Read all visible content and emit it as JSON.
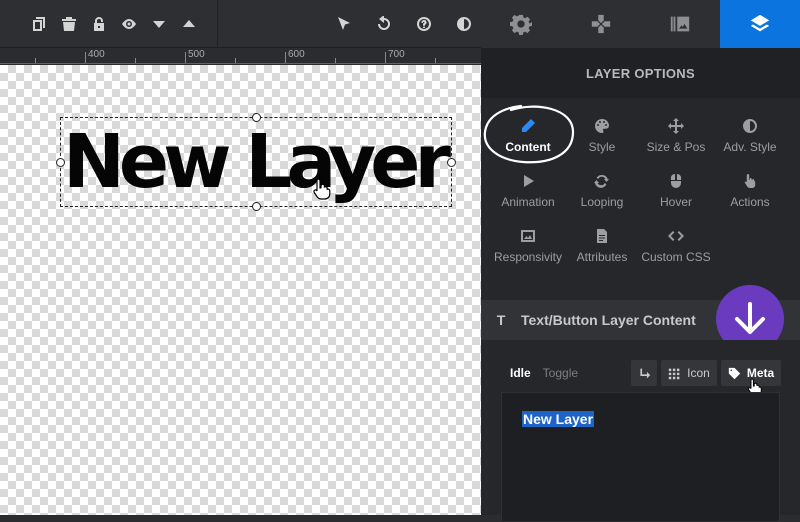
{
  "ruler": {
    "ticks": [
      "400",
      "500",
      "600",
      "700"
    ]
  },
  "canvas": {
    "layer_text": "New Layer"
  },
  "panel": {
    "title": "LAYER OPTIONS",
    "options": [
      {
        "label": "Content",
        "icon": "pencil-icon"
      },
      {
        "label": "Style",
        "icon": "palette-icon"
      },
      {
        "label": "Size & Pos",
        "icon": "move-arrows-icon"
      },
      {
        "label": "Adv. Style",
        "icon": "contrast-icon"
      },
      {
        "label": "Animation",
        "icon": "play-icon"
      },
      {
        "label": "Looping",
        "icon": "loop-icon"
      },
      {
        "label": "Hover",
        "icon": "mouse-icon"
      },
      {
        "label": "Actions",
        "icon": "pointer-hand-icon"
      },
      {
        "label": "Responsivity",
        "icon": "responsive-image-icon"
      },
      {
        "label": "Attributes",
        "icon": "document-icon"
      },
      {
        "label": "Custom CSS",
        "icon": "code-icon"
      }
    ],
    "section_title": "Text/Button Layer Content",
    "state_tabs": {
      "idle": "Idle",
      "toggle": "Toggle"
    },
    "buttons": {
      "icon": "Icon",
      "meta": "Meta"
    },
    "editor_text": "New Layer"
  },
  "colors": {
    "accent": "#0b74de",
    "badge": "#6a3bbf",
    "selection": "#1e64c8"
  }
}
